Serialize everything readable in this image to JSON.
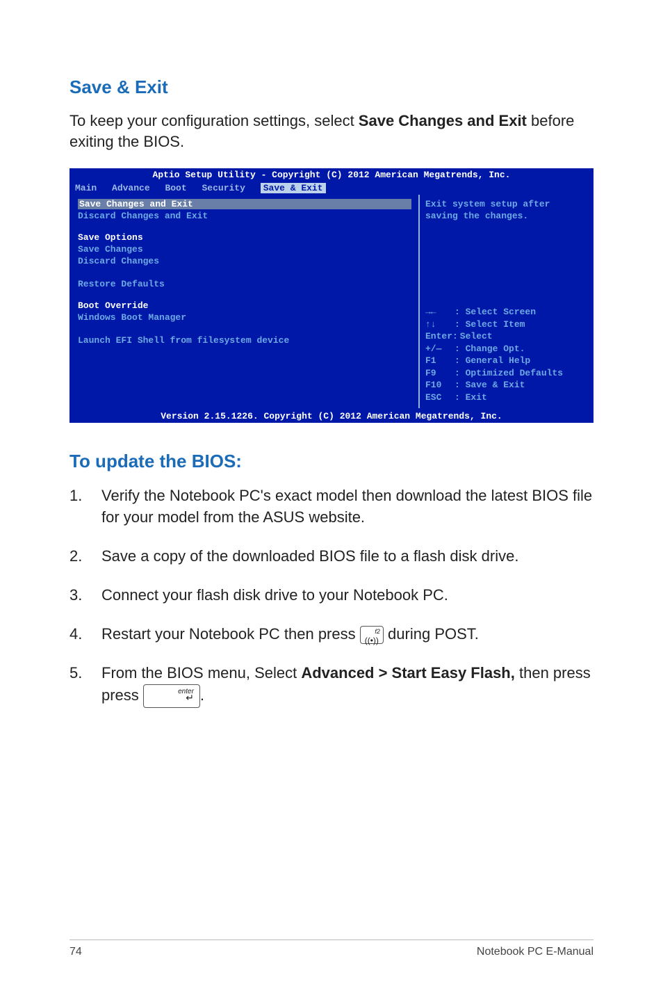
{
  "section1_heading": "Save & Exit",
  "section1_para_pre": "To keep your configuration settings, select ",
  "section1_para_bold": "Save Changes and Exit",
  "section1_para_post": " before exiting the BIOS.",
  "bios": {
    "title": "Aptio Setup Utility - Copyright (C) 2012 American Megatrends, Inc.",
    "tabs": [
      "Main",
      "Advance",
      "Boot",
      "Security",
      "Save & Exit"
    ],
    "left": {
      "selected": "Save Changes and Exit",
      "item1": "Discard Changes and Exit",
      "group1_title": "Save Options",
      "group1_a": "Save Changes",
      "group1_b": "Discard Changes",
      "restore": "Restore Defaults",
      "group2_title": "Boot Override",
      "group2_a": "Windows Boot Manager",
      "launch": "Launch EFI Shell from filesystem device"
    },
    "right": {
      "help1": "Exit system setup after",
      "help2": "saving the changes.",
      "keys": {
        "k1": {
          "k": "→←",
          "d": ": Select Screen"
        },
        "k2": {
          "k": "↑↓",
          "d": ": Select Item"
        },
        "k3": {
          "k": "Enter:",
          "d": " Select"
        },
        "k4": {
          "k": "+/—",
          "d": ": Change Opt."
        },
        "k5": {
          "k": "F1",
          "d": ": General Help"
        },
        "k6": {
          "k": "F9",
          "d": ": Optimized Defaults"
        },
        "k7": {
          "k": "F10",
          "d": ": Save & Exit"
        },
        "k8": {
          "k": "ESC",
          "d": ": Exit"
        }
      }
    },
    "footer": "Version 2.15.1226. Copyright (C) 2012 American Megatrends, Inc."
  },
  "section2_heading": "To update the BIOS:",
  "steps": {
    "s1": "Verify the Notebook PC's exact model then download the latest BIOS file for your model from the ASUS website.",
    "s2": "Save a copy of the downloaded BIOS file to a flash disk drive.",
    "s3": "Connect your flash disk drive to your Notebook PC.",
    "s4_pre": "Restart your Notebook PC then press ",
    "s4_post": " during POST.",
    "s5_pre": "From the BIOS menu, Select ",
    "s5_bold": "Advanced > Start Easy Flash,",
    "s5_mid": " then press ",
    "s5_post": "."
  },
  "step_nums": {
    "n1": "1.",
    "n2": "2.",
    "n3": "3.",
    "n4": "4.",
    "n5": "5."
  },
  "key_f2": {
    "top": "f2"
  },
  "key_enter": {
    "label": "enter",
    "arrow": "↵"
  },
  "footer": {
    "page": "74",
    "title": "Notebook PC E-Manual"
  }
}
